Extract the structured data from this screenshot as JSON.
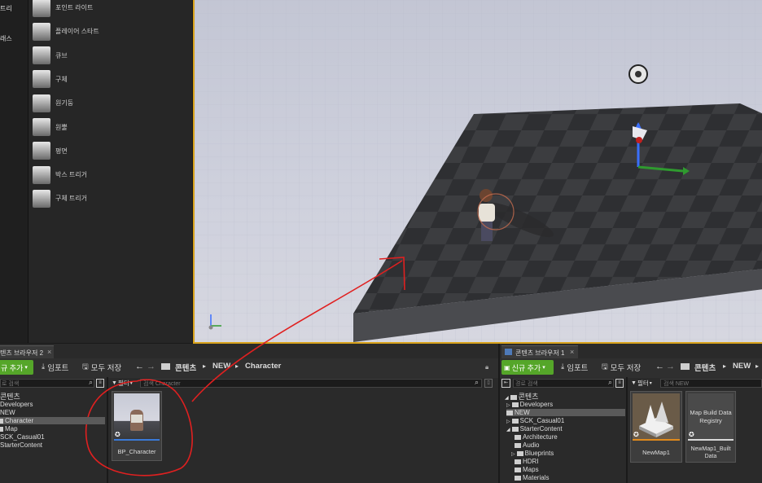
{
  "left_panel": {
    "frag_1": "트리",
    "frag_2": "래스",
    "items": [
      {
        "label": "포인트 라이트",
        "icon": "point-light-icon"
      },
      {
        "label": "플레이어 스타트",
        "icon": "player-start-icon"
      },
      {
        "label": "큐브",
        "icon": "cube-icon"
      },
      {
        "label": "구체",
        "icon": "sphere-icon"
      },
      {
        "label": "원기둥",
        "icon": "cylinder-icon"
      },
      {
        "label": "원뿔",
        "icon": "cone-icon"
      },
      {
        "label": "평면",
        "icon": "plane-icon"
      },
      {
        "label": "박스 트리거",
        "icon": "box-trigger-icon"
      },
      {
        "label": "구체 트리거",
        "icon": "sphere-trigger-icon"
      }
    ]
  },
  "cb2": {
    "tab_label": "텐츠 브라우저 2",
    "add_new": "규 추가",
    "import": "임포트",
    "save_all": "모두 저장",
    "path": [
      "콘텐츠",
      "NEW",
      "Character"
    ],
    "search_folders_placeholder": "로 검색",
    "filters": "필터",
    "search_placeholder": "검색 Character",
    "tree": [
      "콘텐츠",
      "Developers",
      "NEW",
      "Character",
      "Map",
      "SCK_Casual01",
      "StarterContent"
    ],
    "asset_name": "BP_Character"
  },
  "cb1": {
    "tab_label": "콘텐츠 브라우저 1",
    "add_new": "신규 추가",
    "import": "임포트",
    "save_all": "모두 저장",
    "path": [
      "콘텐츠",
      "NEW"
    ],
    "search_folders_placeholder": "경로 검색",
    "filters": "필터",
    "search_placeholder": "검색 NEW",
    "tree": [
      "콘텐츠",
      "Developers",
      "NEW",
      "SCK_Casual01",
      "StarterContent",
      "Architecture",
      "Audio",
      "Blueprints",
      "HDRI",
      "Maps",
      "Materials"
    ],
    "assets": [
      {
        "name": "NewMap1",
        "thumb_text": ""
      },
      {
        "name": "NewMap1_Built Data",
        "thumb_text": "Map Build Data Registry"
      }
    ]
  },
  "colors": {
    "accent_green": "#55a629",
    "selection": "#5a5a5a",
    "viewport_sky": "#c9ccd9",
    "floor_dark": "#3a3b3e",
    "annotation_red": "#e02020",
    "viewport_border": "#d8a21b"
  }
}
